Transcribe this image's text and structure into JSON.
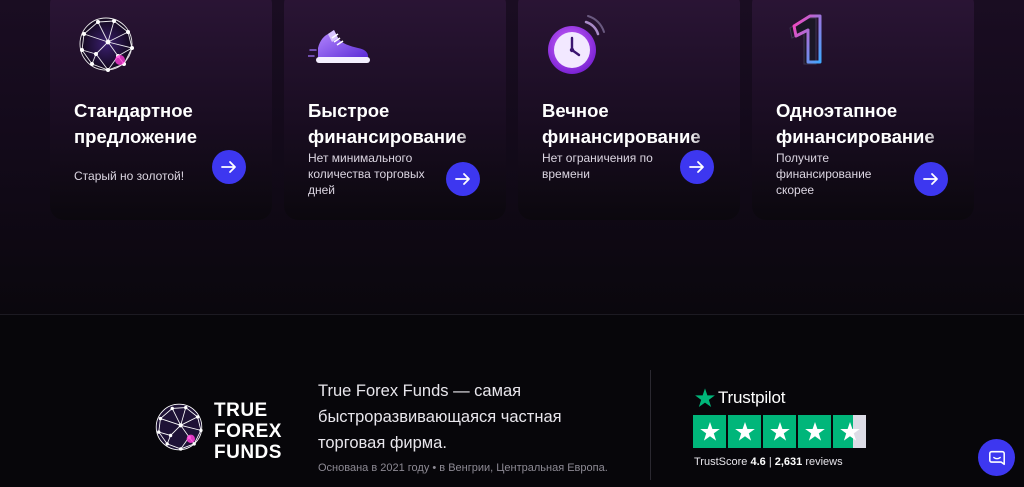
{
  "cards": [
    {
      "title": "Стандартное\nпредложение",
      "description": "Старый но золотой!",
      "icon": "globe-network-icon",
      "arrow_icon": "arrow-right-icon"
    },
    {
      "title": "Быстрое\nфинансирование",
      "description": "Нет минимального количества торговых дней",
      "icon": "sneaker-icon",
      "arrow_icon": "arrow-right-icon"
    },
    {
      "title": "Вечное\nфинансирование",
      "description": "Нет ограничения по времени",
      "icon": "stopwatch-icon",
      "arrow_icon": "arrow-right-icon"
    },
    {
      "title": "Одноэтапное\nфинансирование",
      "description": "Получите финансирование скорее",
      "icon": "number-one-icon",
      "arrow_icon": "arrow-right-icon"
    }
  ],
  "footer": {
    "logo_lines": [
      "TRUE",
      "FOREX",
      "FUNDS"
    ],
    "tagline": "True Forex Funds — самая быстроразвивающаяся частная торговая фирма.",
    "founded": "Основана в 2021 году • в Венгрии, Центральная Европа."
  },
  "trustpilot": {
    "brand": "Trustpilot",
    "score_label": "TrustScore",
    "score": "4.6",
    "separator": "|",
    "reviews": "2,631",
    "reviews_label": "reviews",
    "rating_stars": 4.6,
    "star_color": "#00b67a",
    "empty_color": "#dcdce6"
  },
  "chat": {
    "icon": "chat-bubble-icon"
  },
  "colors": {
    "accent": "#3d37f0",
    "card_top": "#2b1536",
    "background": "#07060a"
  }
}
